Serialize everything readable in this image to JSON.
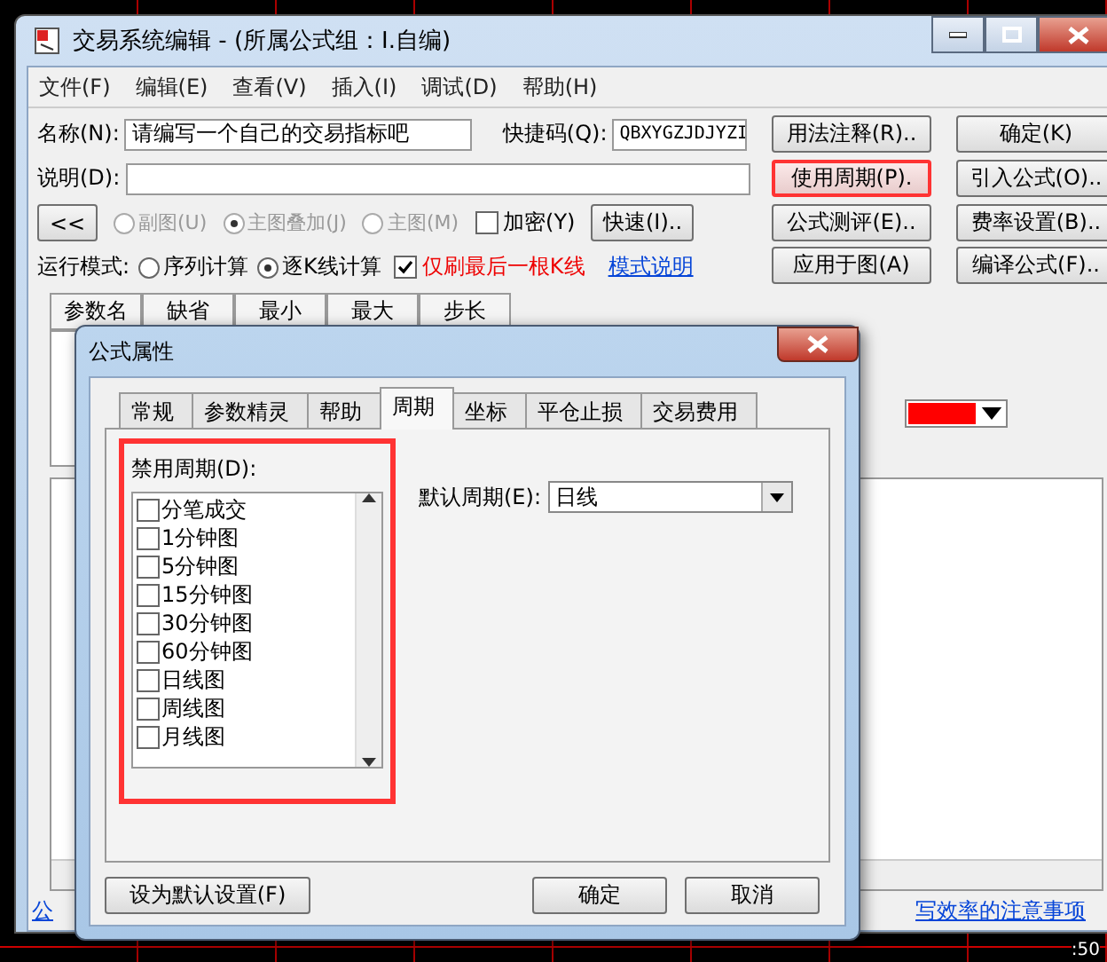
{
  "window": {
    "title": "交易系统编辑 - (所属公式组：I.自编)"
  },
  "menu": [
    "文件(F)",
    "编辑(E)",
    "查看(V)",
    "插入(I)",
    "调试(D)",
    "帮助(H)"
  ],
  "form": {
    "name_label": "名称(N):",
    "name_value": "请编写一个自己的交易指标吧",
    "shortcut_label": "快捷码(Q):",
    "shortcut_value": "QBXYGZJDJYZI",
    "desc_label": "说明(D):"
  },
  "collapse_button": "<<",
  "chart_type_radios": [
    {
      "label": "副图(U)",
      "selected": false,
      "disabled": true
    },
    {
      "label": "主图叠加(J)",
      "selected": true,
      "disabled": true
    },
    {
      "label": "主图(M)",
      "selected": false,
      "disabled": true
    }
  ],
  "encrypt": {
    "label": "加密(Y)",
    "checked": false
  },
  "quick_button": "快速(I)..",
  "run_mode": {
    "label": "运行模式:",
    "options": [
      {
        "label": "序列计算",
        "selected": false
      },
      {
        "label": "逐K线计算",
        "selected": true
      }
    ]
  },
  "refresh_last": {
    "label": "仅刷最后一根K线",
    "checked": true
  },
  "mode_link": "模式说明",
  "side_buttons": [
    {
      "label": "用法注释(R)..",
      "highlighted": false
    },
    {
      "label": "确定(K)",
      "highlighted": false
    },
    {
      "label": "使用周期(P).",
      "highlighted": true
    },
    {
      "label": "引入公式(O)..",
      "highlighted": false
    },
    {
      "label": "公式测评(E)..",
      "highlighted": false
    },
    {
      "label": "费率设置(B)..",
      "highlighted": false
    },
    {
      "label": "应用于图(A)",
      "highlighted": false
    },
    {
      "label": "编译公式(F)..",
      "highlighted": false
    }
  ],
  "param_table": {
    "columns": [
      "参数名",
      "缺省",
      "最小",
      "最大",
      "步长"
    ]
  },
  "color_picker": {
    "color": "#ff0000"
  },
  "bottom_links": [
    "公",
    "写效率的注意事项"
  ],
  "chart_label": ":50",
  "dialog": {
    "title": "公式属性",
    "tabs": [
      {
        "label": "常规",
        "selected": false
      },
      {
        "label": "参数精灵",
        "selected": false
      },
      {
        "label": "帮助",
        "selected": false
      },
      {
        "label": "周期",
        "selected": true
      },
      {
        "label": "坐标",
        "selected": false
      },
      {
        "label": "平仓止损",
        "selected": false
      },
      {
        "label": "交易费用",
        "selected": false
      }
    ],
    "disabled_periods": {
      "label": "禁用周期(D):",
      "highlighted": true,
      "items": [
        {
          "label": "分笔成交",
          "checked": false
        },
        {
          "label": "1分钟图",
          "checked": false
        },
        {
          "label": "5分钟图",
          "checked": false
        },
        {
          "label": "15分钟图",
          "checked": false
        },
        {
          "label": "30分钟图",
          "checked": false
        },
        {
          "label": "60分钟图",
          "checked": false
        },
        {
          "label": "日线图",
          "checked": false
        },
        {
          "label": "周线图",
          "checked": false
        },
        {
          "label": "月线图",
          "checked": false
        }
      ]
    },
    "default_period": {
      "label": "默认周期(E):",
      "value": "日线"
    },
    "buttons": [
      {
        "label": "设为默认设置(F)",
        "kind": "left"
      },
      {
        "label": "确定",
        "kind": "right"
      },
      {
        "label": "取消",
        "kind": "right"
      }
    ]
  }
}
